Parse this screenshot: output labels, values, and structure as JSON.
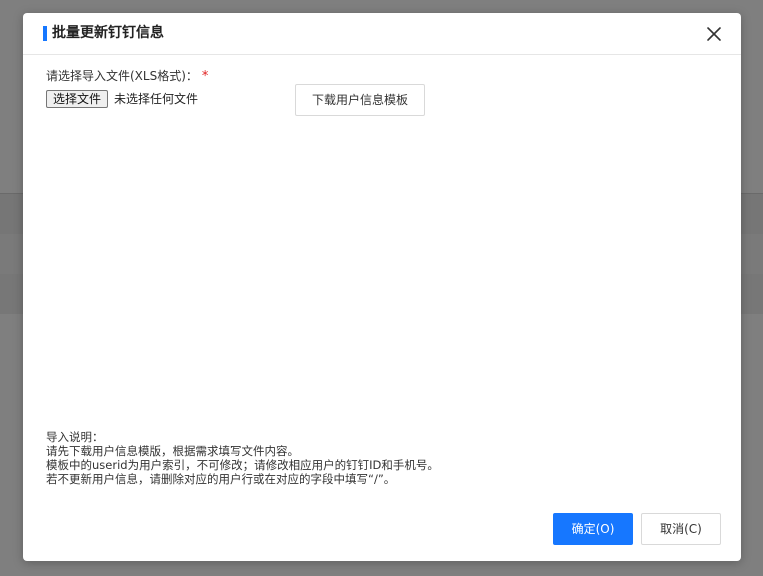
{
  "dialog": {
    "title": "批量更新钉钉信息",
    "close_icon": "close-icon",
    "accent_color": "#1677ff"
  },
  "upload": {
    "label": "请选择导入文件(XLS格式)：",
    "required_mark": "*",
    "choose_button_label": "选择文件",
    "file_status": "未选择任何文件",
    "download_template_label": "下载用户信息模板"
  },
  "instructions": {
    "heading": "导入说明：",
    "lines": [
      "请先下载用户信息模版，根据需求填写文件内容。",
      "模板中的userid为用户索引，不可修改；请修改相应用户的钉钉ID和手机号。",
      "若不更新用户信息，请删除对应的用户行或在对应的字段中填写“/”。"
    ]
  },
  "footer": {
    "ok_label": "确定(O)",
    "cancel_label": "取消(C)"
  }
}
